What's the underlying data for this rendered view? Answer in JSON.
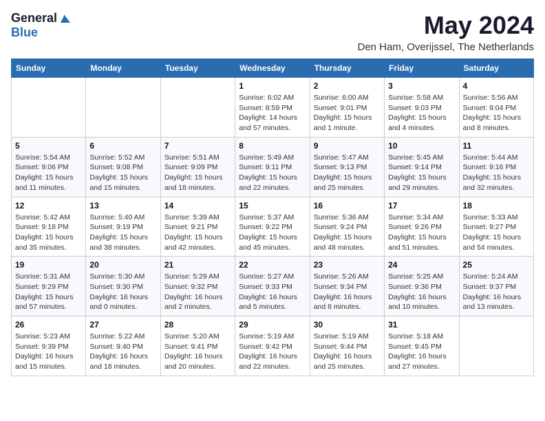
{
  "logo": {
    "general": "General",
    "blue": "Blue"
  },
  "title": "May 2024",
  "subtitle": "Den Ham, Overijssel, The Netherlands",
  "days_header": [
    "Sunday",
    "Monday",
    "Tuesday",
    "Wednesday",
    "Thursday",
    "Friday",
    "Saturday"
  ],
  "weeks": [
    [
      {
        "num": "",
        "info": ""
      },
      {
        "num": "",
        "info": ""
      },
      {
        "num": "",
        "info": ""
      },
      {
        "num": "1",
        "info": "Sunrise: 6:02 AM\nSunset: 8:59 PM\nDaylight: 14 hours\nand 57 minutes."
      },
      {
        "num": "2",
        "info": "Sunrise: 6:00 AM\nSunset: 9:01 PM\nDaylight: 15 hours\nand 1 minute."
      },
      {
        "num": "3",
        "info": "Sunrise: 5:58 AM\nSunset: 9:03 PM\nDaylight: 15 hours\nand 4 minutes."
      },
      {
        "num": "4",
        "info": "Sunrise: 5:56 AM\nSunset: 9:04 PM\nDaylight: 15 hours\nand 8 minutes."
      }
    ],
    [
      {
        "num": "5",
        "info": "Sunrise: 5:54 AM\nSunset: 9:06 PM\nDaylight: 15 hours\nand 11 minutes."
      },
      {
        "num": "6",
        "info": "Sunrise: 5:52 AM\nSunset: 9:08 PM\nDaylight: 15 hours\nand 15 minutes."
      },
      {
        "num": "7",
        "info": "Sunrise: 5:51 AM\nSunset: 9:09 PM\nDaylight: 15 hours\nand 18 minutes."
      },
      {
        "num": "8",
        "info": "Sunrise: 5:49 AM\nSunset: 9:11 PM\nDaylight: 15 hours\nand 22 minutes."
      },
      {
        "num": "9",
        "info": "Sunrise: 5:47 AM\nSunset: 9:13 PM\nDaylight: 15 hours\nand 25 minutes."
      },
      {
        "num": "10",
        "info": "Sunrise: 5:45 AM\nSunset: 9:14 PM\nDaylight: 15 hours\nand 29 minutes."
      },
      {
        "num": "11",
        "info": "Sunrise: 5:44 AM\nSunset: 9:16 PM\nDaylight: 15 hours\nand 32 minutes."
      }
    ],
    [
      {
        "num": "12",
        "info": "Sunrise: 5:42 AM\nSunset: 9:18 PM\nDaylight: 15 hours\nand 35 minutes."
      },
      {
        "num": "13",
        "info": "Sunrise: 5:40 AM\nSunset: 9:19 PM\nDaylight: 15 hours\nand 38 minutes."
      },
      {
        "num": "14",
        "info": "Sunrise: 5:39 AM\nSunset: 9:21 PM\nDaylight: 15 hours\nand 42 minutes."
      },
      {
        "num": "15",
        "info": "Sunrise: 5:37 AM\nSunset: 9:22 PM\nDaylight: 15 hours\nand 45 minutes."
      },
      {
        "num": "16",
        "info": "Sunrise: 5:36 AM\nSunset: 9:24 PM\nDaylight: 15 hours\nand 48 minutes."
      },
      {
        "num": "17",
        "info": "Sunrise: 5:34 AM\nSunset: 9:26 PM\nDaylight: 15 hours\nand 51 minutes."
      },
      {
        "num": "18",
        "info": "Sunrise: 5:33 AM\nSunset: 9:27 PM\nDaylight: 15 hours\nand 54 minutes."
      }
    ],
    [
      {
        "num": "19",
        "info": "Sunrise: 5:31 AM\nSunset: 9:29 PM\nDaylight: 15 hours\nand 57 minutes."
      },
      {
        "num": "20",
        "info": "Sunrise: 5:30 AM\nSunset: 9:30 PM\nDaylight: 16 hours\nand 0 minutes."
      },
      {
        "num": "21",
        "info": "Sunrise: 5:29 AM\nSunset: 9:32 PM\nDaylight: 16 hours\nand 2 minutes."
      },
      {
        "num": "22",
        "info": "Sunrise: 5:27 AM\nSunset: 9:33 PM\nDaylight: 16 hours\nand 5 minutes."
      },
      {
        "num": "23",
        "info": "Sunrise: 5:26 AM\nSunset: 9:34 PM\nDaylight: 16 hours\nand 8 minutes."
      },
      {
        "num": "24",
        "info": "Sunrise: 5:25 AM\nSunset: 9:36 PM\nDaylight: 16 hours\nand 10 minutes."
      },
      {
        "num": "25",
        "info": "Sunrise: 5:24 AM\nSunset: 9:37 PM\nDaylight: 16 hours\nand 13 minutes."
      }
    ],
    [
      {
        "num": "26",
        "info": "Sunrise: 5:23 AM\nSunset: 9:39 PM\nDaylight: 16 hours\nand 15 minutes."
      },
      {
        "num": "27",
        "info": "Sunrise: 5:22 AM\nSunset: 9:40 PM\nDaylight: 16 hours\nand 18 minutes."
      },
      {
        "num": "28",
        "info": "Sunrise: 5:20 AM\nSunset: 9:41 PM\nDaylight: 16 hours\nand 20 minutes."
      },
      {
        "num": "29",
        "info": "Sunrise: 5:19 AM\nSunset: 9:42 PM\nDaylight: 16 hours\nand 22 minutes."
      },
      {
        "num": "30",
        "info": "Sunrise: 5:19 AM\nSunset: 9:44 PM\nDaylight: 16 hours\nand 25 minutes."
      },
      {
        "num": "31",
        "info": "Sunrise: 5:18 AM\nSunset: 9:45 PM\nDaylight: 16 hours\nand 27 minutes."
      },
      {
        "num": "",
        "info": ""
      }
    ]
  ]
}
